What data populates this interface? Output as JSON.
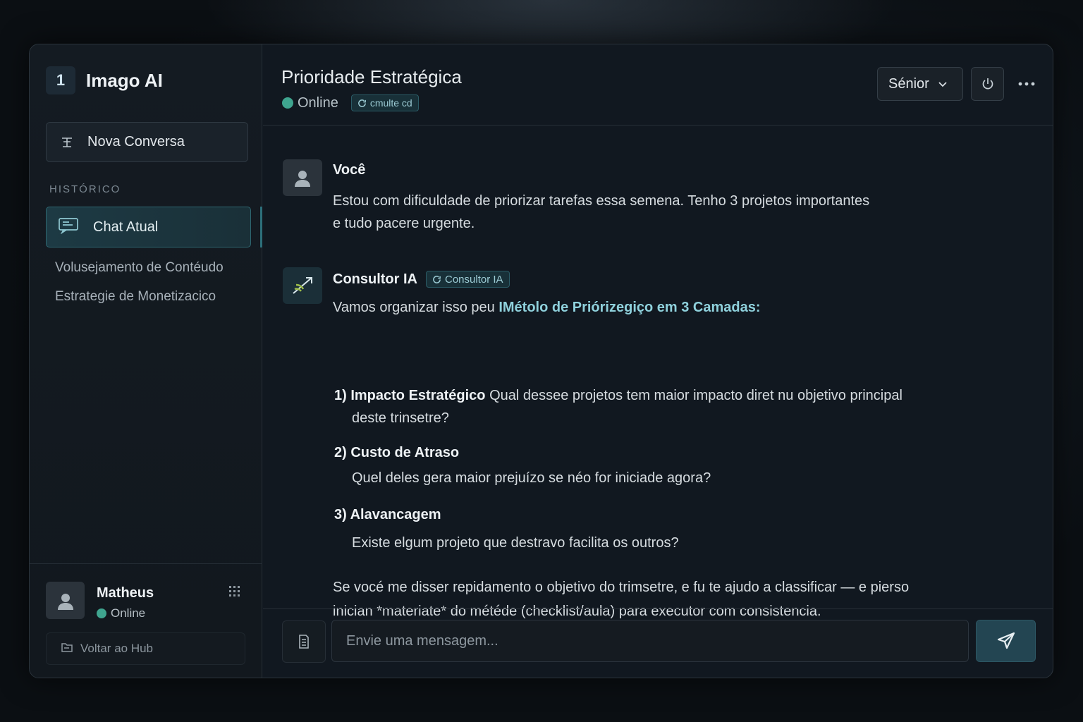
{
  "sidebar": {
    "brand_badge": "1",
    "brand_name": "Imago AI",
    "new_chat_label": "Nova Conversa",
    "section_label": "HISTÓRICO",
    "active_chat_label": "Chat Atual",
    "history": [
      "Volusejamento de Contéudo",
      "Estrategie de Monetizacico"
    ],
    "user": {
      "name": "Matheus",
      "status": "Online"
    },
    "back_label": "Voltar ao Hub"
  },
  "header": {
    "title": "Prioridade Estratégica",
    "status": "Online",
    "status_pill": "cmulte cd",
    "level_select": "Sénior"
  },
  "messages": {
    "user": {
      "author": "Você",
      "text_line1": "Estou com dificuldade de priorizar tarefas essa semena. Tenho 3 projetos importantes",
      "text_line2": "e tudo pacere urgente."
    },
    "ai": {
      "author": "Consultor IA",
      "badge": "Consultor IA",
      "intro_prefix": "Vamos organizar isso peu ",
      "intro_highlight": "IMétolo de Priórizegiço em 3 Camadas:",
      "steps": [
        {
          "title": "1) Impacto Estratégico",
          "desc": "Qual dessee projetos tem maior impacto diret nu objetivo principal",
          "desc2": "deste trinsetre?"
        },
        {
          "title": "2) Custo de Atraso",
          "desc": "Quel deles gera maior prejuízo se néo for iniciade agora?"
        },
        {
          "title": "3) Alavancagem",
          "desc": "Existe elgum projeto que destravo facilita os outros?"
        }
      ],
      "closing_line1": "Se vocé me disser repidamento o objetivo do trimsetre, e fu te ajudo a classificar — e pierso",
      "closing_line2": "inician *materiate* do météde (checklist/aula) para executor com consistencia."
    }
  },
  "composer": {
    "placeholder": "Envie uma mensagem..."
  },
  "colors": {
    "accent": "#2d6f7a",
    "online": "#3fa58f",
    "highlight": "#8fd1dc"
  }
}
